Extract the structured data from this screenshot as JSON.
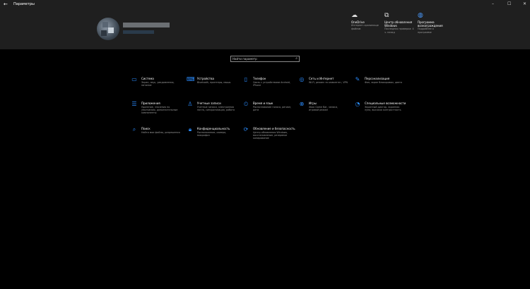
{
  "window": {
    "title": "Параметры",
    "back_icon": "arrow-left-icon",
    "controls": [
      "minimize-icon",
      "maximize-icon",
      "close-icon"
    ]
  },
  "header": {
    "links": [
      {
        "icon": "cloud-icon",
        "title": "OneDrive",
        "desc": "Интернет-хранилище файлов"
      },
      {
        "icon": "update-center-icon",
        "title": "Центр обновления Windows",
        "desc": "Последняя проверка: 4 ч. назад"
      },
      {
        "icon": "rewards-globe-icon",
        "title": "Программа вознаграждения",
        "desc": "Подробнее о программе"
      }
    ]
  },
  "search": {
    "placeholder": "Найти параметр"
  },
  "tiles": [
    {
      "icon": "laptop-icon",
      "title": "Система",
      "desc": "Экран, звук, уведомления, питание"
    },
    {
      "icon": "devices-icon",
      "title": "Устройства",
      "desc": "Bluetooth, принтеры, мышь"
    },
    {
      "icon": "phone-icon",
      "title": "Телефон",
      "desc": "Связь с устройствами Android, iPhone"
    },
    {
      "icon": "globe-icon",
      "title": "Сеть и Интернет",
      "desc": "Wi-Fi, режим «в самолете», VPN"
    },
    {
      "icon": "personalization-icon",
      "title": "Персонализация",
      "desc": "Фон, экран блокировки, цвета"
    },
    {
      "icon": "apps-list-icon",
      "title": "Приложения",
      "desc": "Удаление, значения по умолчанию, дополнительные компоненты"
    },
    {
      "icon": "person-icon",
      "title": "Учетные записи",
      "desc": "Учетные записи, электронная почта, синхронизация, работа"
    },
    {
      "icon": "clock-language-icon",
      "title": "Время и язык",
      "desc": "Распознавание голоса, регион, дата"
    },
    {
      "icon": "xbox-icon",
      "title": "Игры",
      "desc": "Xbox Game Bar, записи, игровой режим"
    },
    {
      "icon": "accessibility-icon",
      "title": "Специальные возможности",
      "desc": "Экранный диктор, экранная лупа, высокая контрастность"
    },
    {
      "icon": "search-icon",
      "title": "Поиск",
      "desc": "Найти мои файлы, разрешения"
    },
    {
      "icon": "lock-icon",
      "title": "Конфиденциальность",
      "desc": "Расположение, камера, микрофон"
    },
    {
      "icon": "sync-icon",
      "title": "Обновление и безопасность",
      "desc": "Центр обновления Windows, восстановление, резервное копирование"
    }
  ]
}
